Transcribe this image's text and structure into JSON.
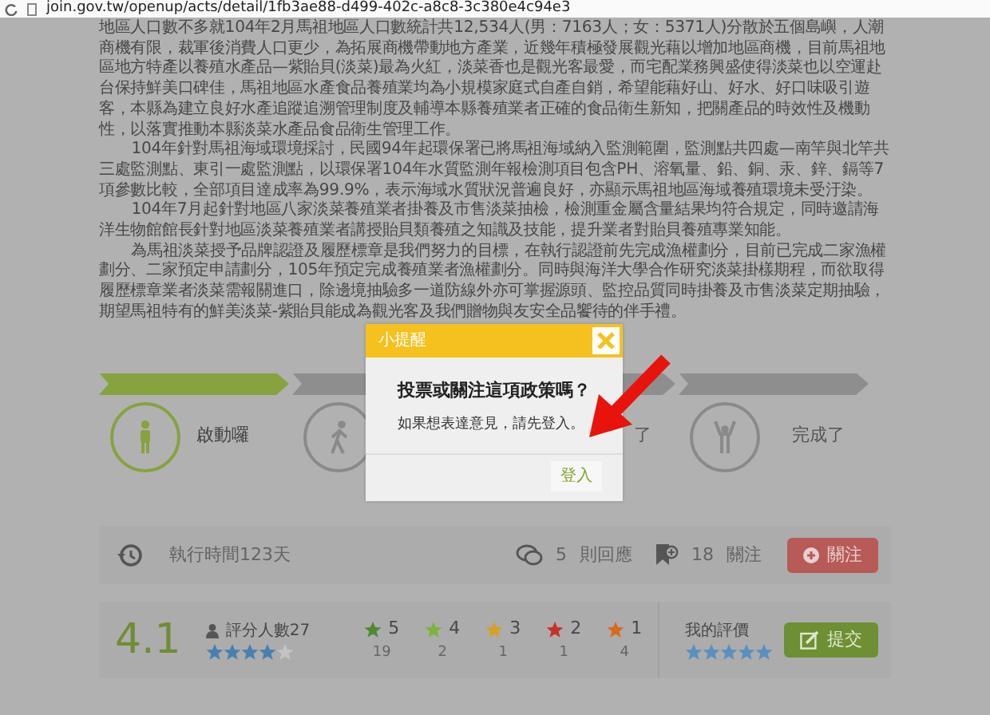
{
  "address_bar": {
    "url": "join.gov.tw/openup/acts/detail/1fb3ae88-d499-402c-a8c8-3c380e4c94e3"
  },
  "article": {
    "paragraphs": [
      {
        "indent": false,
        "text": "地區人口數不多就104年2月馬祖地區人口數統計共12,534人(男：7163人；女：5371人)分散於五個島嶼，人潮商機有限，裁軍後消費人口更少，為拓展商機帶動地方產業，近幾年積極發展觀光藉以增加地區商機，目前馬祖地區地方特產以養殖水產品—紫貽貝(淡菜)最為火紅，淡菜香也是觀光客最愛，而宅配業務興盛使得淡菜也以空運赴台保持鮮美口碑佳，馬祖地區水產食品養殖業均為小規模家庭式自產自銷，希望能藉好山、好水、好口味吸引遊客，本縣為建立良好水產追蹤追溯管理制度及輔導本縣養殖業者正確的食品衛生新知，把關產品的時效性及機動性，以落實推動本縣淡菜水產品食品衛生管理工作。"
      },
      {
        "indent": true,
        "text": "104年針對馬祖海域環境採討，民國94年起環保署已將馬祖海域納入監測範圍，監測點共四處—南竿與北竿共三處監測點、東引一處監測點，以環保署104年水質監測年報檢測項目包含PH、溶氧量、鉛、銅、汞、鋅、鎘等7項參數比較，全部項目達成率為99.9%，表示海域水質狀況普遍良好，亦顯示馬祖地區海域養殖環境未受汙染。"
      },
      {
        "indent": true,
        "text": "104年7月起針對地區八家淡菜養殖業者掛養及市售淡菜抽檢，檢測重金屬含量結果均符合規定，同時邀請海洋生物館館長針對地區淡菜養殖業者講授貽貝類養殖之知識及技能，提升業者對貽貝養殖專業知能。"
      },
      {
        "indent": true,
        "text": "為馬祖淡菜授予品牌認證及履歷標章是我們努力的目標，在執行認證前先完成漁權劃分，目前已完成二家漁權劃分、二家預定申請劃分，105年預定完成養殖業者漁權劃分。同時與海洋大學合作研究淡菜掛樣期程，而欲取得履歷標章業者淡菜需報關進口，除邊境抽驗多一道防線外亦可掌握源頭、監控品質同時掛養及市售淡菜定期抽驗，期望馬祖特有的鮮美淡菜-紫貽貝能成為觀光客及我們贈物與友安全品饗待的伴手禮。"
      }
    ]
  },
  "progress_steps": [
    {
      "kind": "standing",
      "label": "啟動囉",
      "selected": true
    },
    {
      "kind": "walking",
      "selected": false
    },
    {
      "kind": "hidden",
      "label": "了",
      "selected": false
    },
    {
      "kind": "cheering",
      "label": "完成了",
      "selected": false
    }
  ],
  "stats_bar": {
    "duration": "執行時間123天",
    "replies_count": "5",
    "replies_label": "則回應",
    "follows_count": "18",
    "follows_label": "關注",
    "follow_button": "關注"
  },
  "rating": {
    "score": "4.1",
    "raters": "評分人數27",
    "stars": 4,
    "breakdown": [
      {
        "star": "5",
        "count": "19",
        "color": "#4f8a2e"
      },
      {
        "star": "4",
        "count": "2",
        "color": "#7db33a"
      },
      {
        "star": "3",
        "count": "1",
        "color": "#d6a21e"
      },
      {
        "star": "2",
        "count": "1",
        "color": "#c9302c"
      },
      {
        "star": "1",
        "count": "4",
        "color": "#d9691c"
      }
    ],
    "my_rating": {
      "label": "我的評價",
      "stars": 5
    },
    "submit_button": "提交"
  },
  "dialog": {
    "title": "小提醒",
    "question": "投票或關注這項政策嗎？",
    "message": "如果想表達意見，請先登入。",
    "login_button": "登入"
  }
}
